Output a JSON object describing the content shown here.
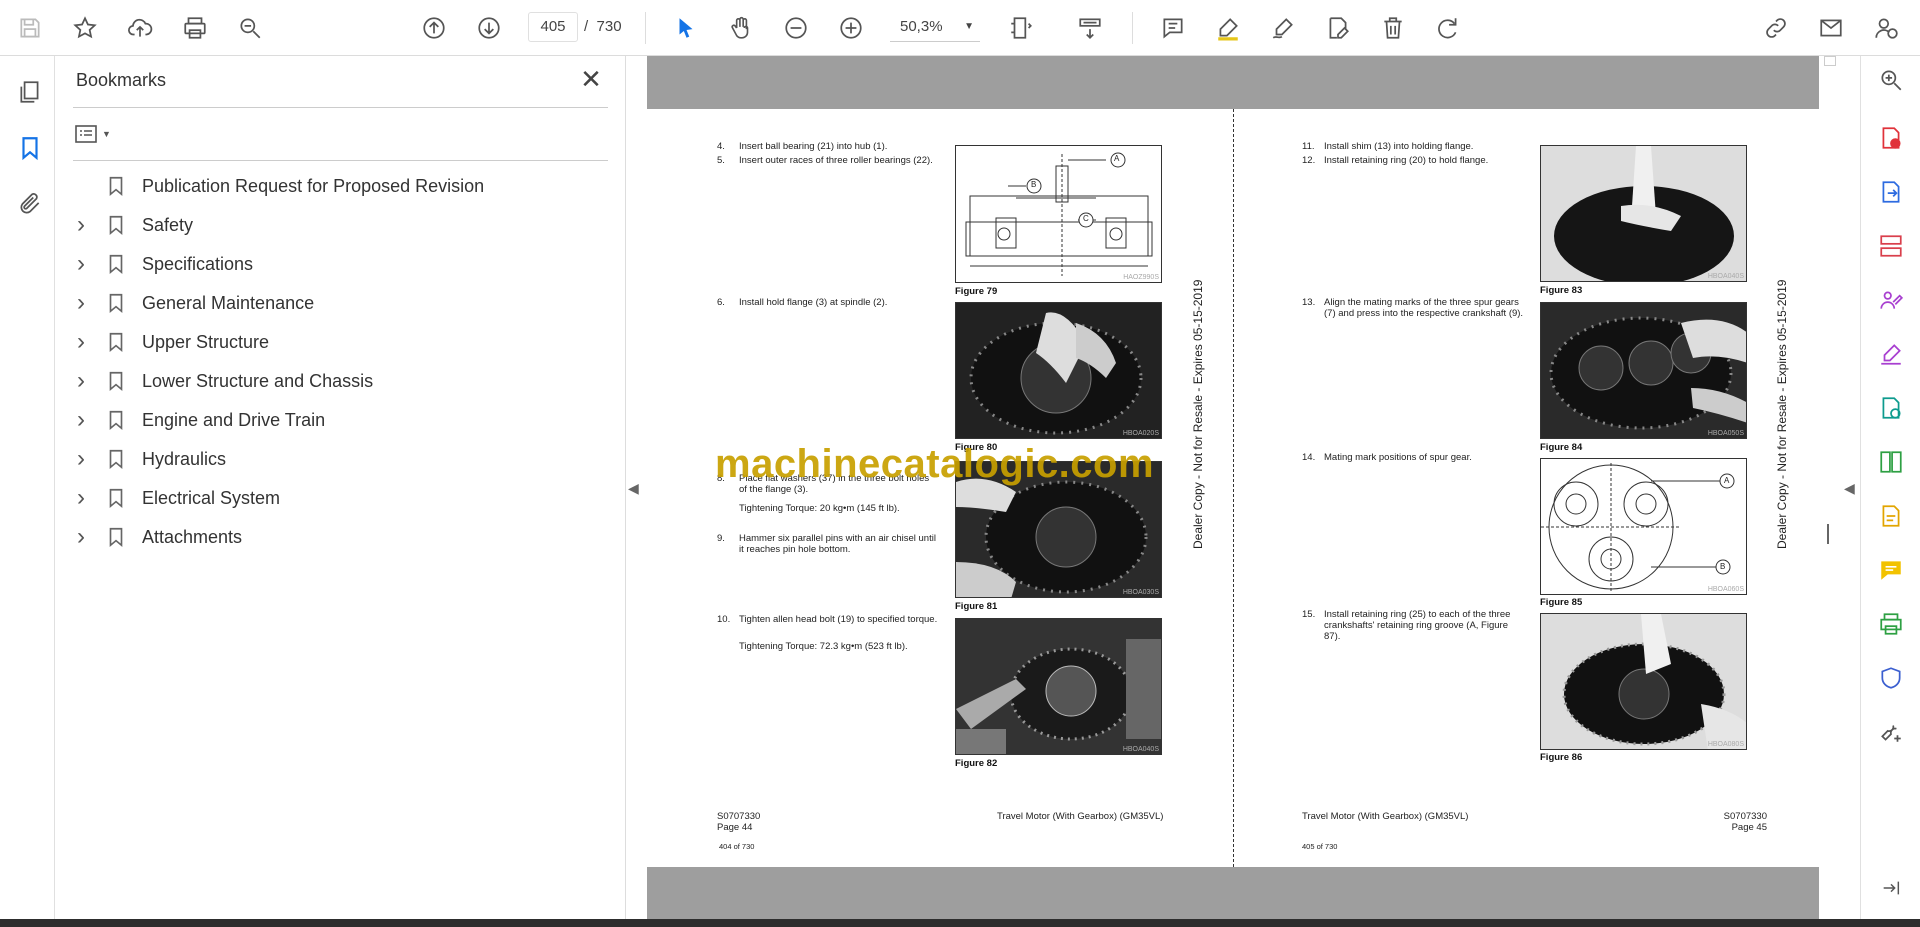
{
  "toolbar": {
    "current_page": "405",
    "page_separator": "/",
    "total_pages": "730",
    "zoom": "50,3%"
  },
  "bookmarks_panel": {
    "title": "Bookmarks",
    "items": [
      {
        "label": "Publication Request for Proposed Revision",
        "expandable": false
      },
      {
        "label": "Safety",
        "expandable": true
      },
      {
        "label": "Specifications",
        "expandable": true
      },
      {
        "label": "General Maintenance",
        "expandable": true
      },
      {
        "label": "Upper Structure",
        "expandable": true
      },
      {
        "label": "Lower Structure and Chassis",
        "expandable": true
      },
      {
        "label": "Engine and Drive Train",
        "expandable": true
      },
      {
        "label": "Hydraulics",
        "expandable": true
      },
      {
        "label": "Electrical System",
        "expandable": true
      },
      {
        "label": "Attachments",
        "expandable": true
      }
    ]
  },
  "document": {
    "left_page": {
      "steps": [
        {
          "num": "4.",
          "text": "Insert ball bearing (21) into hub (1)."
        },
        {
          "num": "5.",
          "text": "Insert outer races of three roller bearings (22)."
        },
        {
          "num": "6.",
          "text": "Install hold flange (3) at spindle (2)."
        },
        {
          "num": "8.",
          "text": "Place flat washers (37) in the three bolt holes of the flange (3)."
        },
        {
          "num": "",
          "text": "Tightening Torque: 20 kg•m (145 ft lb)."
        },
        {
          "num": "9.",
          "text": "Hammer six parallel pins with an air chisel until it reaches pin hole bottom."
        },
        {
          "num": "10.",
          "text": "Tighten allen head bolt (19) to specified torque."
        },
        {
          "num": "",
          "text": "Tightening Torque: 72.3 kg•m (523 ft lb)."
        }
      ],
      "figures": [
        {
          "caption": "Figure 79",
          "code": "HAOZ990S",
          "labels": [
            "A",
            "B",
            "C"
          ]
        },
        {
          "caption": "Figure 80",
          "code": "HBOA020S"
        },
        {
          "caption": "Figure 81",
          "code": "HBOA030S"
        },
        {
          "caption": "Figure 82",
          "code": "HBOA040S"
        }
      ],
      "side_text": "Dealer Copy - Not for Resale - Expires 05-15-2019",
      "footer_code": "S0707330",
      "footer_page": "Page 44",
      "footer_title": "Travel Motor (With Gearbox) (GM35VL)",
      "footer_count": "404 of 730"
    },
    "right_page": {
      "steps": [
        {
          "num": "11.",
          "text": "Install shim (13) into holding flange."
        },
        {
          "num": "12.",
          "text": "Install retaining ring (20) to hold flange."
        },
        {
          "num": "13.",
          "text": "Align the mating marks of the three spur gears (7) and press into the respective crankshaft (9)."
        },
        {
          "num": "14.",
          "text": "Mating mark positions of spur gear."
        },
        {
          "num": "15.",
          "text": "Install retaining ring (25) to each of the three crankshafts' retaining ring groove (A, Figure 87)."
        }
      ],
      "figures": [
        {
          "caption": "Figure 83",
          "code": "HBOA040S"
        },
        {
          "caption": "Figure 84",
          "code": "HBOA050S"
        },
        {
          "caption": "Figure 85",
          "code": "HBOA060S",
          "labels": [
            "A",
            "B"
          ]
        },
        {
          "caption": "Figure 86",
          "code": "HBOA080S"
        }
      ],
      "side_text": "Dealer Copy - Not for Resale - Expires 05-15-2019",
      "footer_code": "S0707330",
      "footer_page": "Page 45",
      "footer_title": "Travel Motor (With Gearbox) (GM35VL)",
      "footer_count": "405 of 730"
    },
    "watermark": "machinecatalogic.com"
  }
}
